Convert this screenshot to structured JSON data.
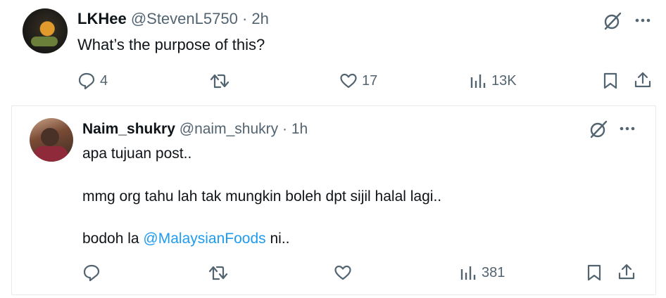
{
  "tweet": {
    "display_name": "LKHee",
    "handle": "@StevenL5750",
    "separator": "·",
    "time": "2h",
    "text": "What’s the purpose of this?",
    "replies": "4",
    "likes": "17",
    "views": "13K"
  },
  "quote": {
    "display_name": "Naim_shukry",
    "handle": "@naim_shukry",
    "separator": "·",
    "time": "1h",
    "line1": "apa tujuan post..",
    "line2": "mmg org tahu lah tak mungkin boleh dpt sijil halal lagi..",
    "line3_prefix": "bodoh la ",
    "mention": "@MalaysianFoods",
    "line3_suffix": " ni..",
    "views": "381"
  },
  "colors": {
    "text": "#0f1419",
    "muted": "#536471",
    "link": "#1d9bf0",
    "border": "#e7e9ea"
  },
  "icons": [
    "grok-icon",
    "more-icon",
    "reply-icon",
    "retweet-icon",
    "like-icon",
    "views-icon",
    "bookmark-icon",
    "share-icon"
  ]
}
